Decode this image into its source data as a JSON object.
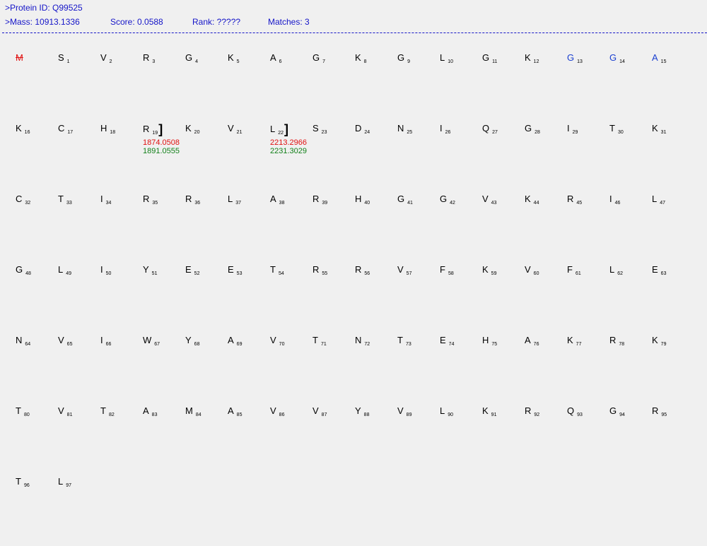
{
  "header": {
    "protein_id": ">Protein ID: Q99525",
    "mass": ">Mass: 10913.1336",
    "score": "Score: 0.0588",
    "rank": "Rank: ?????",
    "matches": "Matches: 3"
  },
  "colors": {
    "header": "#1515c8",
    "highlight": "#1a3fd0",
    "removed": "#e01010",
    "mass_primary": "#e01010",
    "mass_secondary": "#13801a"
  },
  "sequence": [
    {
      "aa": "M",
      "i": "",
      "style": "removed"
    },
    {
      "aa": "S",
      "i": "1"
    },
    {
      "aa": "V",
      "i": "2"
    },
    {
      "aa": "R",
      "i": "3"
    },
    {
      "aa": "G",
      "i": "4"
    },
    {
      "aa": "K",
      "i": "5"
    },
    {
      "aa": "A",
      "i": "6"
    },
    {
      "aa": "G",
      "i": "7"
    },
    {
      "aa": "K",
      "i": "8"
    },
    {
      "aa": "G",
      "i": "9"
    },
    {
      "aa": "L",
      "i": "10"
    },
    {
      "aa": "G",
      "i": "11"
    },
    {
      "aa": "K",
      "i": "12"
    },
    {
      "aa": "G",
      "i": "13",
      "style": "blue"
    },
    {
      "aa": "G",
      "i": "14",
      "style": "blue"
    },
    {
      "aa": "A",
      "i": "15",
      "style": "blue"
    },
    {
      "aa": "K",
      "i": "16"
    },
    {
      "aa": "C",
      "i": "17"
    },
    {
      "aa": "H",
      "i": "18"
    },
    {
      "aa": "R",
      "i": "19",
      "bracket": true,
      "masses": [
        "1874.0508",
        "1891.0555"
      ]
    },
    {
      "aa": "K",
      "i": "20"
    },
    {
      "aa": "V",
      "i": "21"
    },
    {
      "aa": "L",
      "i": "22",
      "bracket": true,
      "masses": [
        "2213.2966",
        "2231.3029"
      ]
    },
    {
      "aa": "S",
      "i": "23"
    },
    {
      "aa": "D",
      "i": "24"
    },
    {
      "aa": "N",
      "i": "25"
    },
    {
      "aa": "I",
      "i": "26"
    },
    {
      "aa": "Q",
      "i": "27"
    },
    {
      "aa": "G",
      "i": "28"
    },
    {
      "aa": "I",
      "i": "29"
    },
    {
      "aa": "T",
      "i": "30"
    },
    {
      "aa": "K",
      "i": "31"
    },
    {
      "aa": "C",
      "i": "32"
    },
    {
      "aa": "T",
      "i": "33"
    },
    {
      "aa": "I",
      "i": "34"
    },
    {
      "aa": "R",
      "i": "35"
    },
    {
      "aa": "R",
      "i": "36"
    },
    {
      "aa": "L",
      "i": "37"
    },
    {
      "aa": "A",
      "i": "38"
    },
    {
      "aa": "R",
      "i": "39"
    },
    {
      "aa": "H",
      "i": "40"
    },
    {
      "aa": "G",
      "i": "41"
    },
    {
      "aa": "G",
      "i": "42"
    },
    {
      "aa": "V",
      "i": "43"
    },
    {
      "aa": "K",
      "i": "44"
    },
    {
      "aa": "R",
      "i": "45"
    },
    {
      "aa": "I",
      "i": "46"
    },
    {
      "aa": "L",
      "i": "47"
    },
    {
      "aa": "G",
      "i": "48"
    },
    {
      "aa": "L",
      "i": "49"
    },
    {
      "aa": "I",
      "i": "50"
    },
    {
      "aa": "Y",
      "i": "51"
    },
    {
      "aa": "E",
      "i": "52"
    },
    {
      "aa": "E",
      "i": "53"
    },
    {
      "aa": "T",
      "i": "54"
    },
    {
      "aa": "R",
      "i": "55"
    },
    {
      "aa": "R",
      "i": "56"
    },
    {
      "aa": "V",
      "i": "57"
    },
    {
      "aa": "F",
      "i": "58"
    },
    {
      "aa": "K",
      "i": "59"
    },
    {
      "aa": "V",
      "i": "60"
    },
    {
      "aa": "F",
      "i": "61"
    },
    {
      "aa": "L",
      "i": "62"
    },
    {
      "aa": "E",
      "i": "63"
    },
    {
      "aa": "N",
      "i": "64"
    },
    {
      "aa": "V",
      "i": "65"
    },
    {
      "aa": "I",
      "i": "66"
    },
    {
      "aa": "W",
      "i": "67"
    },
    {
      "aa": "Y",
      "i": "68"
    },
    {
      "aa": "A",
      "i": "69"
    },
    {
      "aa": "V",
      "i": "70"
    },
    {
      "aa": "T",
      "i": "71"
    },
    {
      "aa": "N",
      "i": "72"
    },
    {
      "aa": "T",
      "i": "73"
    },
    {
      "aa": "E",
      "i": "74"
    },
    {
      "aa": "H",
      "i": "75"
    },
    {
      "aa": "A",
      "i": "76"
    },
    {
      "aa": "K",
      "i": "77"
    },
    {
      "aa": "R",
      "i": "78"
    },
    {
      "aa": "K",
      "i": "79"
    },
    {
      "aa": "T",
      "i": "80"
    },
    {
      "aa": "V",
      "i": "81"
    },
    {
      "aa": "T",
      "i": "82"
    },
    {
      "aa": "A",
      "i": "83"
    },
    {
      "aa": "M",
      "i": "84"
    },
    {
      "aa": "A",
      "i": "85"
    },
    {
      "aa": "V",
      "i": "86"
    },
    {
      "aa": "V",
      "i": "87"
    },
    {
      "aa": "Y",
      "i": "88"
    },
    {
      "aa": "V",
      "i": "89"
    },
    {
      "aa": "L",
      "i": "90"
    },
    {
      "aa": "K",
      "i": "91"
    },
    {
      "aa": "R",
      "i": "92"
    },
    {
      "aa": "Q",
      "i": "93"
    },
    {
      "aa": "G",
      "i": "94"
    },
    {
      "aa": "R",
      "i": "95"
    },
    {
      "aa": "T",
      "i": "96"
    },
    {
      "aa": "L",
      "i": "97"
    }
  ]
}
